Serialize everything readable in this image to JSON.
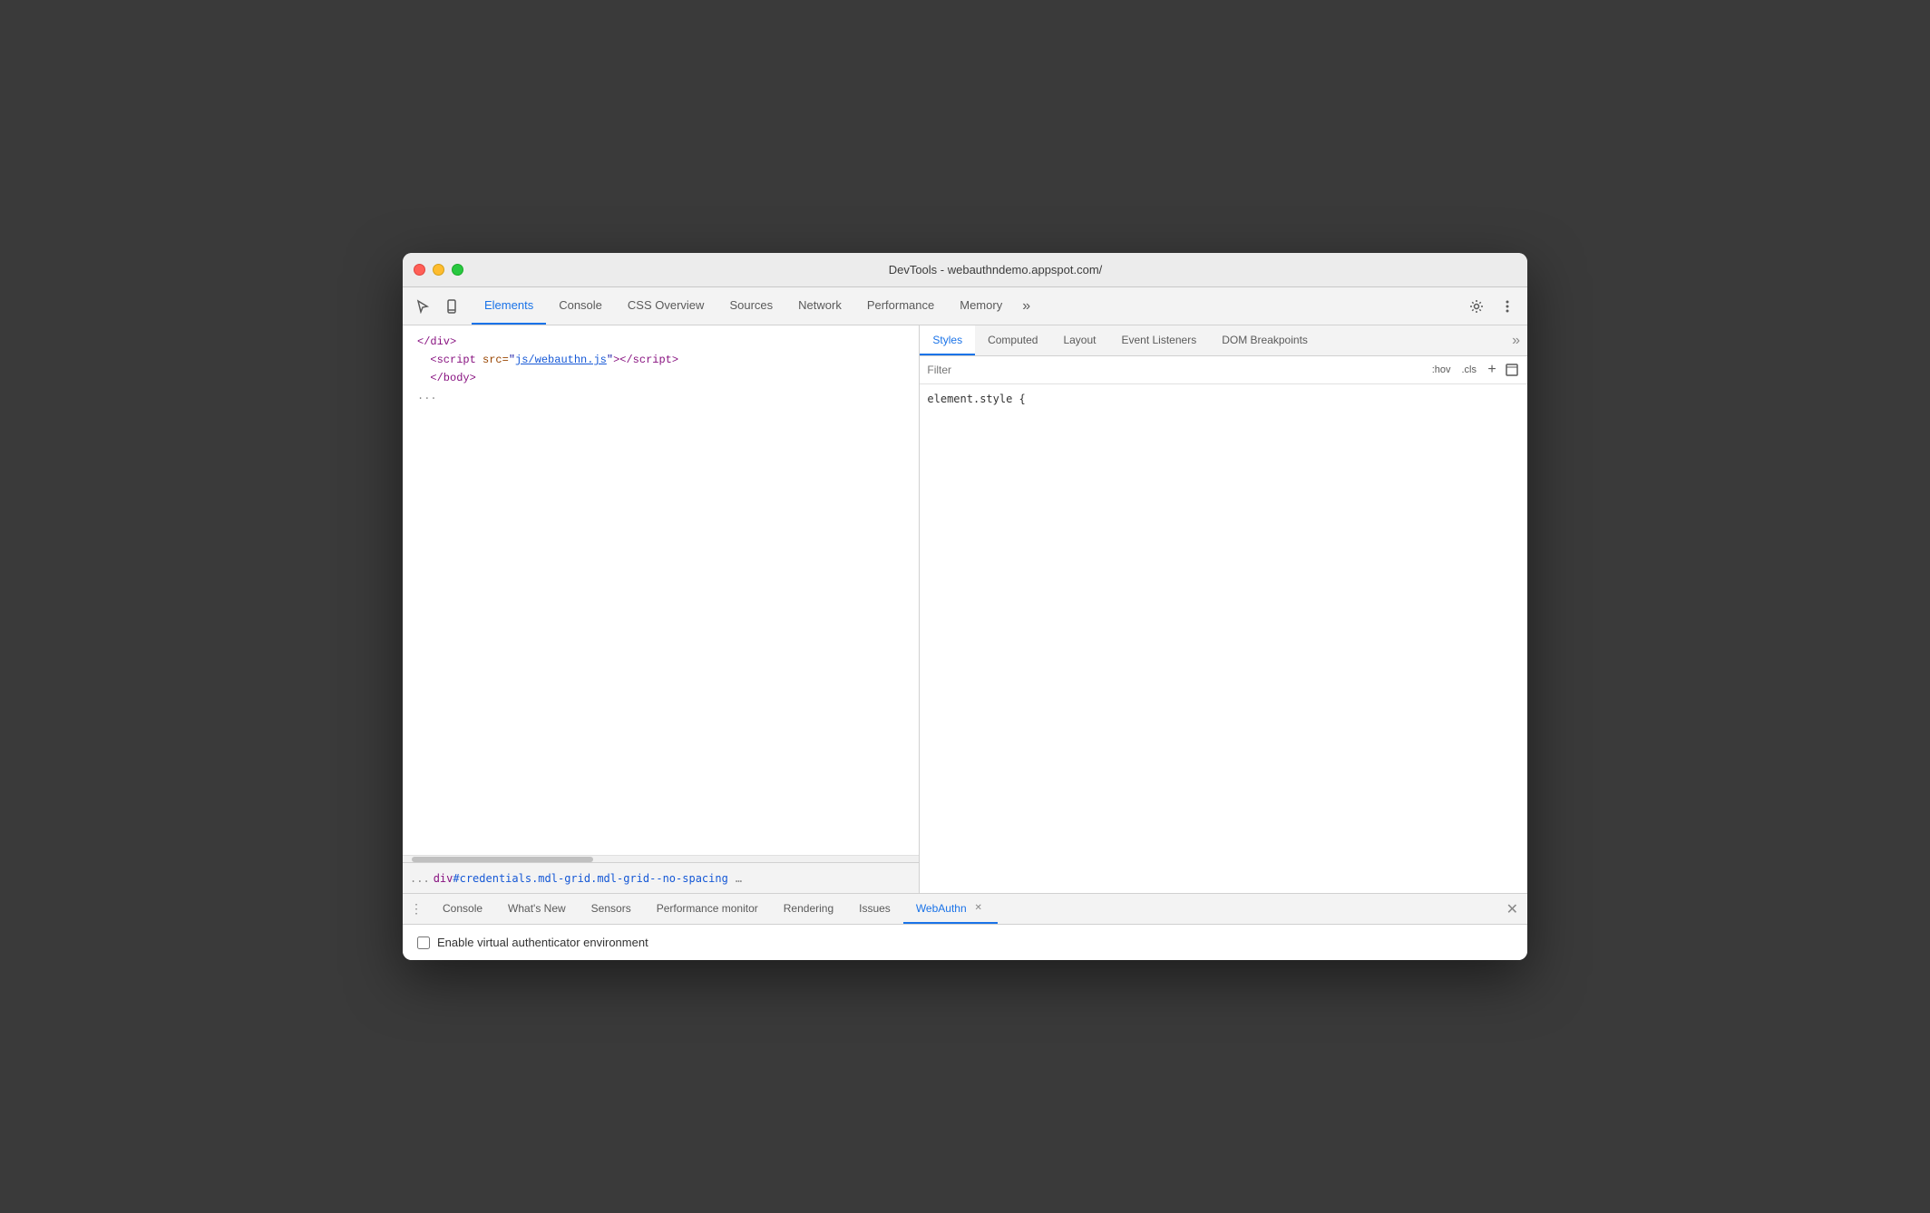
{
  "window": {
    "title": "DevTools - webauthndemo.appspot.com/"
  },
  "toolbar": {
    "tabs": [
      {
        "id": "elements",
        "label": "Elements",
        "active": true
      },
      {
        "id": "console",
        "label": "Console",
        "active": false
      },
      {
        "id": "css-overview",
        "label": "CSS Overview",
        "active": false
      },
      {
        "id": "sources",
        "label": "Sources",
        "active": false
      },
      {
        "id": "network",
        "label": "Network",
        "active": false
      },
      {
        "id": "performance",
        "label": "Performance",
        "active": false
      },
      {
        "id": "memory",
        "label": "Memory",
        "active": false
      }
    ],
    "more_label": "»"
  },
  "dom": {
    "lines": [
      {
        "html": "&lt;/div&gt;",
        "type": "tag"
      },
      {
        "html": "&lt;script src=\"js/webauthn.js\"&gt;&lt;/script&gt;",
        "type": "script"
      },
      {
        "html": "&lt;/body&gt;",
        "type": "tag"
      },
      {
        "html": "...",
        "type": "ellipsis"
      }
    ]
  },
  "breadcrumb": {
    "more": "...",
    "item": "div#credentials.mdl-grid.mdl-grid--no-spacing",
    "dots": "..."
  },
  "styles_panel": {
    "tabs": [
      {
        "id": "styles",
        "label": "Styles",
        "active": true
      },
      {
        "id": "computed",
        "label": "Computed",
        "active": false
      },
      {
        "id": "layout",
        "label": "Layout",
        "active": false
      },
      {
        "id": "event-listeners",
        "label": "Event Listeners",
        "active": false
      },
      {
        "id": "dom-breakpoints",
        "label": "DOM Breakpoints",
        "active": false
      }
    ],
    "filter_placeholder": "Filter",
    "filter_hov": ":hov",
    "filter_cls": ".cls",
    "filter_add": "+",
    "style_rule": "element.style {"
  },
  "drawer": {
    "tabs": [
      {
        "id": "console",
        "label": "Console",
        "active": false,
        "closeable": false
      },
      {
        "id": "whats-new",
        "label": "What's New",
        "active": false,
        "closeable": false
      },
      {
        "id": "sensors",
        "label": "Sensors",
        "active": false,
        "closeable": false
      },
      {
        "id": "performance-monitor",
        "label": "Performance monitor",
        "active": false,
        "closeable": false
      },
      {
        "id": "rendering",
        "label": "Rendering",
        "active": false,
        "closeable": false
      },
      {
        "id": "issues",
        "label": "Issues",
        "active": false,
        "closeable": false
      },
      {
        "id": "webauthn",
        "label": "WebAuthn",
        "active": true,
        "closeable": true
      }
    ],
    "checkbox_label": "Enable virtual authenticator environment"
  }
}
